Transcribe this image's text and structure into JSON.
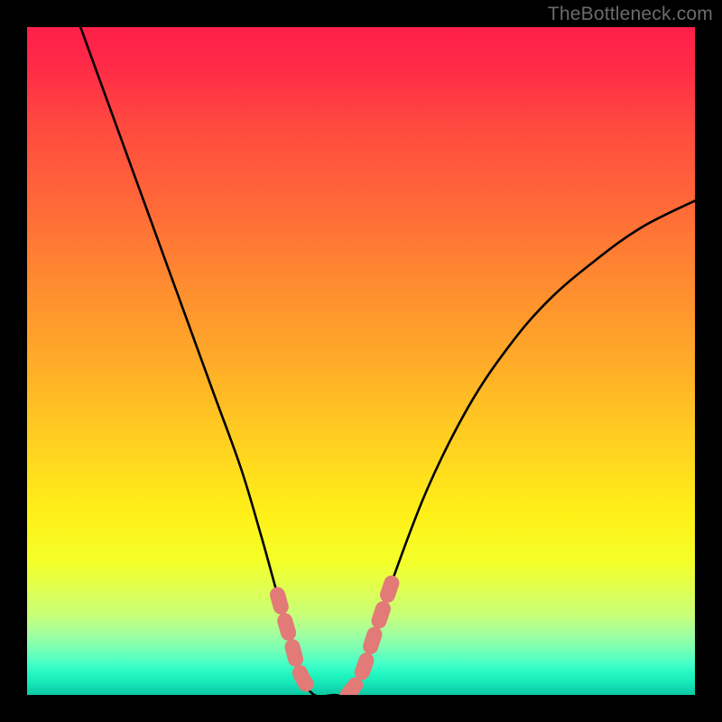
{
  "watermark": "TheBottleneck.com",
  "chart_data": {
    "type": "line",
    "title": "",
    "xlabel": "",
    "ylabel": "",
    "xlim": [
      0,
      100
    ],
    "ylim": [
      0,
      100
    ],
    "series": [
      {
        "name": "bottleneck-curve",
        "x": [
          8,
          12,
          16,
          20,
          24,
          28,
          32,
          35,
          37.5,
          39.5,
          41,
          43,
          46,
          48,
          50,
          52,
          55,
          60,
          66,
          72,
          78,
          85,
          92,
          100
        ],
        "y": [
          100,
          89,
          78,
          67,
          56,
          45,
          34,
          24,
          15,
          8,
          3,
          0,
          0,
          0,
          3,
          9,
          18,
          31,
          43,
          52,
          59,
          65,
          70,
          74
        ]
      }
    ],
    "annotations": {
      "highlight_segments": [
        {
          "name": "left-flank",
          "x": [
            37.5,
            39.5,
            41,
            43
          ],
          "y": [
            15,
            8,
            3,
            0
          ]
        },
        {
          "name": "right-flank",
          "x": [
            48,
            50,
            52,
            55
          ],
          "y": [
            0,
            3,
            9,
            18
          ]
        }
      ],
      "highlight_color": "#e27a78"
    },
    "gradient_stops": [
      {
        "pos": 0,
        "color": "#ff1f4a"
      },
      {
        "pos": 0.5,
        "color": "#ffab28"
      },
      {
        "pos": 0.8,
        "color": "#f4ff28"
      },
      {
        "pos": 1.0,
        "color": "#0cc8a4"
      }
    ]
  }
}
